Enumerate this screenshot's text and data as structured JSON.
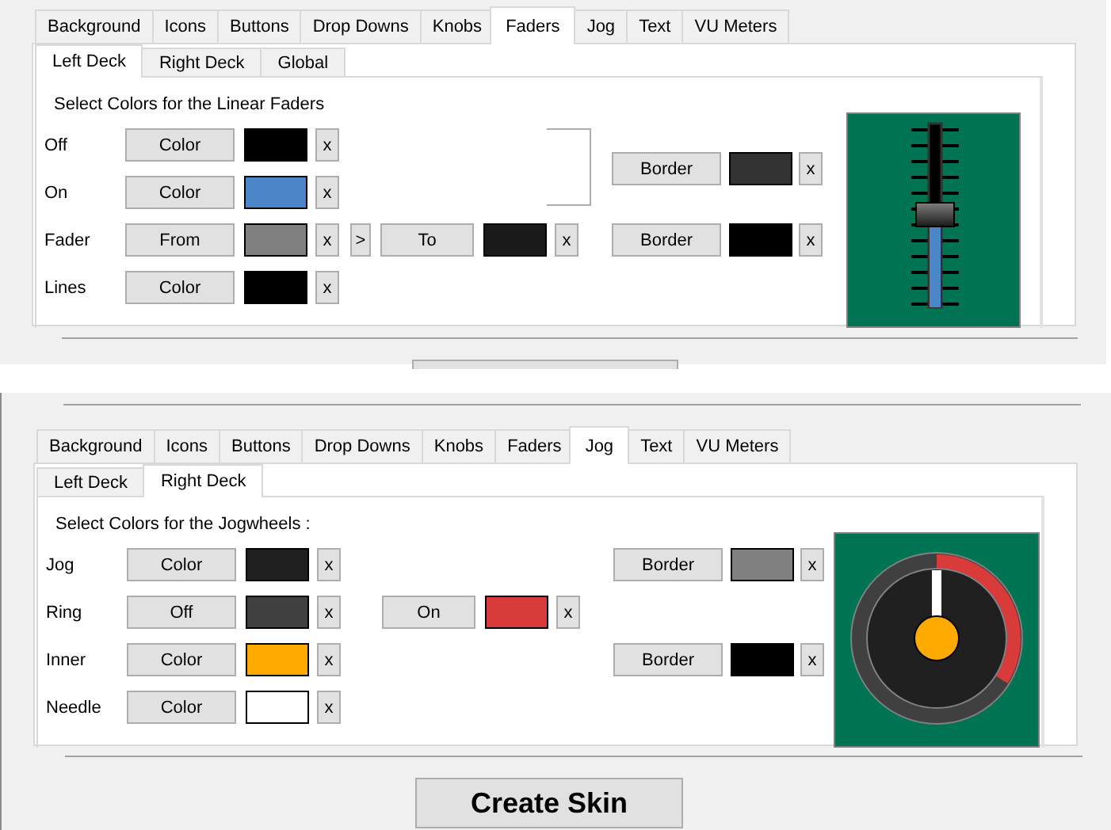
{
  "panels": [
    {
      "tabs": [
        {
          "label": "Background",
          "selected": false
        },
        {
          "label": "Icons",
          "selected": false
        },
        {
          "label": "Buttons",
          "selected": false
        },
        {
          "label": "Drop Downs",
          "selected": false
        },
        {
          "label": "Knobs",
          "selected": false
        },
        {
          "label": "Faders",
          "selected": true
        },
        {
          "label": "Jog",
          "selected": false
        },
        {
          "label": "Text",
          "selected": false
        },
        {
          "label": "VU Meters",
          "selected": false
        }
      ],
      "subtabs": [
        {
          "label": "Left Deck",
          "selected": true
        },
        {
          "label": "Right Deck",
          "selected": false
        },
        {
          "label": "Global",
          "selected": false
        }
      ],
      "heading": "Select Colors for the Linear Faders",
      "rows": [
        {
          "label": "Off",
          "controls": [
            {
              "kind": "color",
              "button": "Color",
              "color": "#000000",
              "clear": "x"
            }
          ]
        },
        {
          "label": "On",
          "controls": [
            {
              "kind": "color",
              "button": "Color",
              "color": "#4a86c8",
              "clear": "x"
            }
          ]
        },
        {
          "label": "Fader",
          "controls": [
            {
              "kind": "color",
              "button": "From",
              "color": "#808080",
              "clear": "x"
            },
            {
              "kind": "step",
              "button": ">"
            },
            {
              "kind": "color",
              "button": "To",
              "color": "#1a1a1a",
              "clear": "x"
            }
          ]
        },
        {
          "label": "Lines",
          "controls": [
            {
              "kind": "color",
              "button": "Color",
              "color": "#000000",
              "clear": "x"
            }
          ]
        }
      ],
      "borders": [
        {
          "button": "Border",
          "color": "#333333",
          "clear": "x"
        },
        {
          "button": "Border",
          "color": "#000000",
          "clear": "x"
        }
      ],
      "preview": {
        "kind": "fader",
        "level": 0.5
      }
    },
    {
      "tabs": [
        {
          "label": "Background",
          "selected": false
        },
        {
          "label": "Icons",
          "selected": false
        },
        {
          "label": "Buttons",
          "selected": false
        },
        {
          "label": "Drop Downs",
          "selected": false
        },
        {
          "label": "Knobs",
          "selected": false
        },
        {
          "label": "Faders",
          "selected": false
        },
        {
          "label": "Jog",
          "selected": true
        },
        {
          "label": "Text",
          "selected": false
        },
        {
          "label": "VU Meters",
          "selected": false
        }
      ],
      "subtabs": [
        {
          "label": "Left Deck",
          "selected": false
        },
        {
          "label": "Right Deck",
          "selected": true
        }
      ],
      "heading": "Select Colors for the Jogwheels :",
      "rows": [
        {
          "label": "Jog",
          "controls": [
            {
              "kind": "color",
              "button": "Color",
              "color": "#202020",
              "clear": "x"
            }
          ]
        },
        {
          "label": "Ring",
          "controls": [
            {
              "kind": "color",
              "button": "Off",
              "color": "#404040",
              "clear": "x"
            },
            {
              "kind": "color",
              "button": "On",
              "color": "#d93a3a",
              "clear": "x"
            }
          ]
        },
        {
          "label": "Inner",
          "controls": [
            {
              "kind": "color",
              "button": "Color",
              "color": "#ffaa00",
              "clear": "x"
            }
          ]
        },
        {
          "label": "Needle",
          "controls": [
            {
              "kind": "color",
              "button": "Color",
              "color": "#ffffff",
              "clear": "x"
            }
          ]
        }
      ],
      "borders": [
        {
          "button": "Border",
          "color": "#808080",
          "clear": "x"
        },
        {
          "button": "Border",
          "color": "#000000",
          "clear": "x"
        }
      ],
      "preview": {
        "kind": "jog"
      },
      "create_button": "Create Skin"
    }
  ]
}
